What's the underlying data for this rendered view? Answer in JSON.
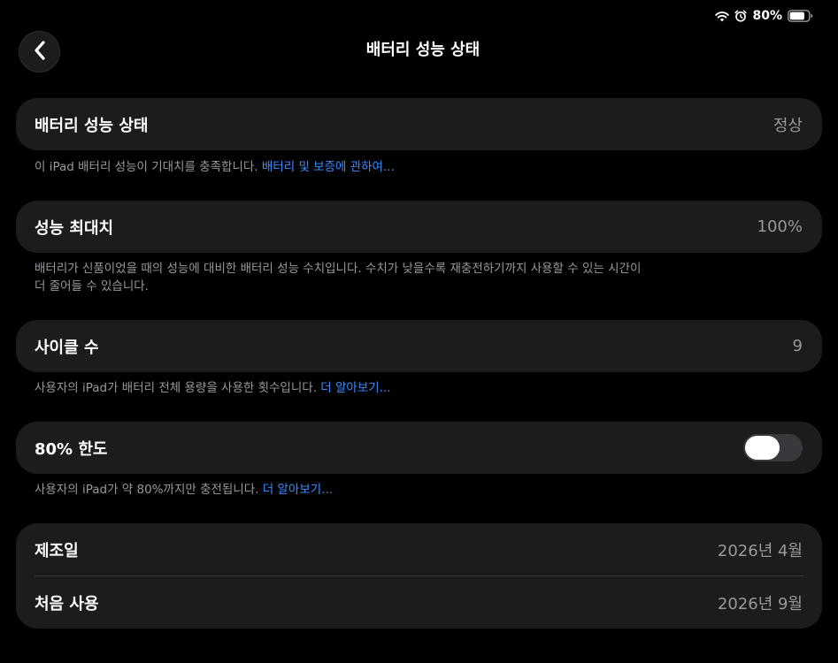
{
  "status_bar": {
    "battery_percent": "80%",
    "battery_level": 0.8,
    "icons": [
      "wifi-icon",
      "alarm-icon",
      "battery-icon"
    ]
  },
  "header": {
    "title": "배터리 성능 상태",
    "back_icon": "chevron-left-icon"
  },
  "battery_health": {
    "label": "배터리 성능 상태",
    "value": "정상",
    "footnote": "이 iPad 배터리 성능이 기대치를 충족합니다. ",
    "footnote_link": "배터리 및 보증에 관하여..."
  },
  "max_capacity": {
    "label": "성능 최대치",
    "value": "100%",
    "footnote_line1": "배터리가 신품이었을 때의 성능에 대비한 배터리 성능 수치입니다. 수치가 낮을수록 재충전하기까지 사용할 수 있는 시간이",
    "footnote_line2": "더 줄어들 수 있습니다."
  },
  "cycle_count": {
    "label": "사이클 수",
    "value": "9",
    "footnote": "사용자의 iPad가 배터리 전체 용량을 사용한 횟수입니다. ",
    "footnote_link": "더 알아보기..."
  },
  "limit_80": {
    "label": "80% 한도",
    "toggle_on": false,
    "footnote": "사용자의 iPad가 약 80%까지만 충전됩니다. ",
    "footnote_link": "더 알아보기..."
  },
  "dates": {
    "manufacture_label": "제조일",
    "manufacture_value": "2026년 4월",
    "first_use_label": "처음 사용",
    "first_use_value": "2026년 9월"
  },
  "colors": {
    "background": "#000000",
    "card": "#1c1c1e",
    "secondary_text": "#98989e",
    "link": "#3a8cff",
    "toggle_off": "#39393d"
  }
}
